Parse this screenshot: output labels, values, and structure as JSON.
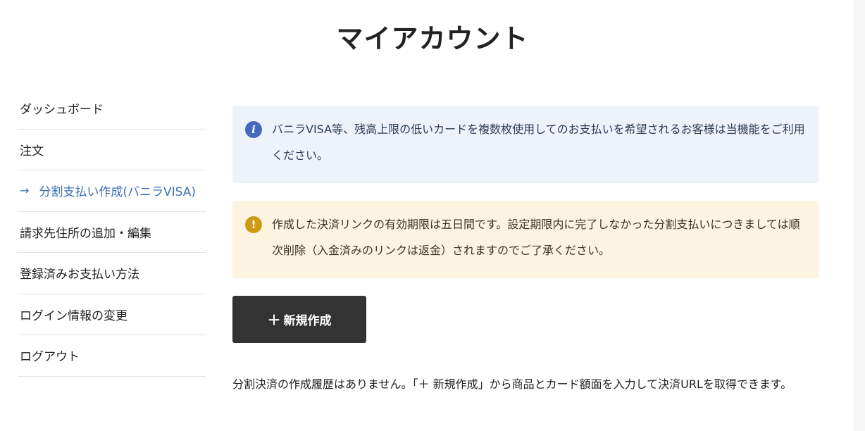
{
  "page": {
    "title": "マイアカウント"
  },
  "sidebar": {
    "items": [
      {
        "label": "ダッシュボード"
      },
      {
        "label": "注文"
      },
      {
        "label": "分割支払い作成(バニラVISA)",
        "arrow": "→"
      },
      {
        "label": "請求先住所の追加・編集"
      },
      {
        "label": "登録済みお支払い方法"
      },
      {
        "label": "ログイン情報の変更"
      },
      {
        "label": "ログアウト"
      }
    ]
  },
  "notices": {
    "info": {
      "icon": "info-icon",
      "text": "バニラVISA等、残高上限の低いカードを複数枚使用してのお支払いを希望されるお客様は当機能をご利用ください。"
    },
    "warning": {
      "icon": "exclamation-icon",
      "text": "作成した決済リンクの有効期限は五日間です。設定期限内に完了しなかった分割支払いにつきましては順次削除（入金済みのリンクは返金）されますのでご了承ください。"
    }
  },
  "actions": {
    "create_label": "新規作成",
    "create_icon": "plus-icon"
  },
  "empty_state": {
    "text": "分割決済の作成履歴はありません。「＋ 新規作成」から商品とカード額面を入力して決済URLを取得できます。"
  },
  "colors": {
    "accent": "#3d6fb6",
    "info_bg": "#eef3fb",
    "info_icon": "#4469bf",
    "warn_bg": "#fcf3e1",
    "warn_icon": "#cf9a12",
    "button_bg": "#333333"
  }
}
